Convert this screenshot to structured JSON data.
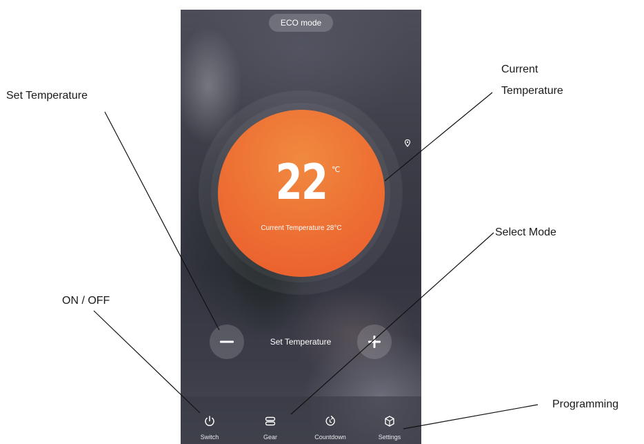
{
  "app": {
    "mode_pill": "ECO mode",
    "set_temperature": {
      "value": "22",
      "unit": "℃"
    },
    "current_temperature_text": "Current Temperature 28°C",
    "set_temperature_label": "Set Temperature",
    "tabs": [
      {
        "label": "Switch",
        "icon": "power-icon"
      },
      {
        "label": "Gear",
        "icon": "gear-stack-icon"
      },
      {
        "label": "Countdown",
        "icon": "countdown-icon"
      },
      {
        "label": "Settings",
        "icon": "settings-cube-icon"
      }
    ]
  },
  "annotations": {
    "set_temperature": "Set Temperature",
    "current_temperature_line1": "Current",
    "current_temperature_line2": "Temperature",
    "select_mode": "Select Mode",
    "on_off": "ON / OFF",
    "programming": "Programming"
  },
  "colors": {
    "dial_orange": "#ee7335",
    "background_dark": "#3b3c46",
    "annotation_text": "#1a1a1a"
  }
}
